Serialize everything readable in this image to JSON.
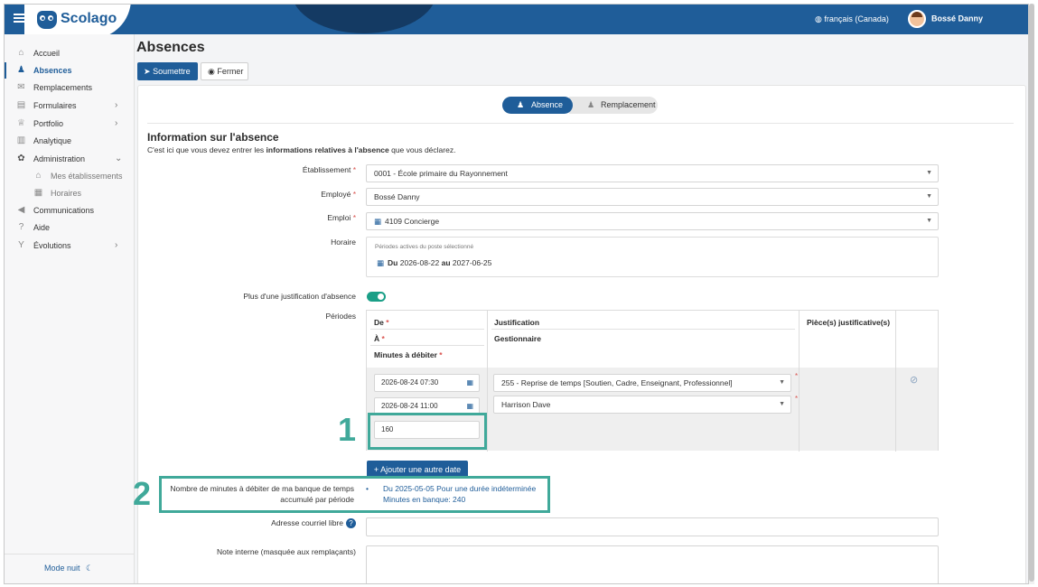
{
  "header": {
    "brand": "Scolago",
    "language": "français (Canada)",
    "user_name": "Bossé Danny"
  },
  "sidebar": {
    "items": [
      {
        "label": "Accueil",
        "icon": "home-icon"
      },
      {
        "label": "Absences",
        "icon": "person-absence-icon",
        "active": true
      },
      {
        "label": "Remplacements",
        "icon": "megaphone-icon"
      },
      {
        "label": "Formulaires",
        "icon": "document-icon",
        "has_children": true
      },
      {
        "label": "Portfolio",
        "icon": "trophy-icon",
        "has_children": true
      },
      {
        "label": "Analytique",
        "icon": "building-icon"
      },
      {
        "label": "Administration",
        "icon": "gear-icon",
        "expanded": true
      },
      {
        "label": "Mes établissements",
        "icon": "school-icon",
        "sub": true
      },
      {
        "label": "Horaires",
        "icon": "calendar-icon",
        "sub": true
      },
      {
        "label": "Communications",
        "icon": "bullhorn-icon"
      },
      {
        "label": "Aide",
        "icon": "question-icon"
      },
      {
        "label": "Évolutions",
        "icon": "evolution-icon",
        "has_children": true
      }
    ],
    "night_mode": "Mode nuit"
  },
  "page": {
    "title": "Absences",
    "submit_label": "Soumettre",
    "close_label": "Fermer"
  },
  "stepper": {
    "step1": "Absence",
    "step2": "Remplacement"
  },
  "form": {
    "section_title": "Information sur l'absence",
    "desc_prefix": "C'est ici que vous devez entrer les ",
    "desc_bold": "informations relatives à l'absence",
    "desc_suffix": " que vous déclarez.",
    "etablissement_label": "Établissement",
    "etablissement_value": "0001 - École primaire du Rayonnement",
    "employe_label": "Employé",
    "employe_value": "Bossé Danny",
    "emploi_label": "Emploi",
    "emploi_value": "4109 Concierge",
    "horaire_label": "Horaire",
    "horaire_note": "Périodes actives du poste sélectionné",
    "horaire_du": "Du",
    "horaire_start": "2026-08-22",
    "horaire_au": "au",
    "horaire_end": "2027-06-25",
    "multi_justif_label": "Plus d'une justification d'absence",
    "periodes_label": "Périodes",
    "col_de": "De",
    "col_a": "À",
    "col_minutes": "Minutes à débiter",
    "col_justification": "Justification",
    "col_gestionnaire": "Gestionnaire",
    "col_pieces": "Pièce(s) justificative(s)",
    "date_start": "2026-08-24 07:30",
    "date_end": "2026-08-24 11:00",
    "minutes_value": "160",
    "justification_value": "255 - Reprise de temps [Soutien, Cadre, Enseignant, Professionnel]",
    "gestionnaire_value": "Harrison Dave",
    "add_date_label": "+ Ajouter une autre date",
    "bank_label": "Nombre de minutes à débiter de ma banque de temps accumulé par période",
    "bank_line1": "Du 2025-05-05 Pour une durée indéterminée",
    "bank_line2": "Minutes en banque: 240",
    "email_label": "Adresse courriel libre",
    "note_label": "Note interne (masquée aux remplaçants)"
  },
  "callouts": {
    "one": "1",
    "two": "2"
  },
  "colors": {
    "primary": "#1f5d99",
    "accent_teal": "#40a99a",
    "toggle_on": "#1a9f87"
  }
}
